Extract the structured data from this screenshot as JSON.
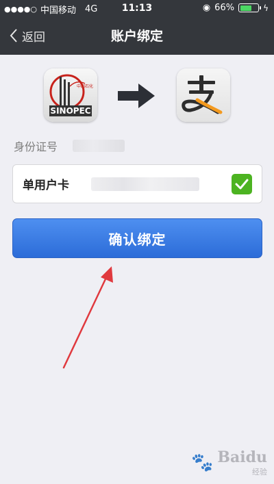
{
  "status_bar": {
    "signal_dots": "●●●●○",
    "carrier": "中国移动",
    "network": "4G",
    "time": "11:13",
    "battery": "66%",
    "battery_level": 0.66
  },
  "nav": {
    "back_label": "返回",
    "title": "账户绑定"
  },
  "logos": {
    "source": "SINOPEC",
    "target": "alipay-logo"
  },
  "form": {
    "id_label": "身份证号",
    "card_label": "单用户卡",
    "checked": true
  },
  "confirm_button": "确认绑定",
  "watermark": {
    "brand": "Baidu",
    "sub": "经验"
  },
  "colors": {
    "header": "#34373c",
    "button": "#3a7ce6",
    "check": "#4cb321",
    "arrow": "#e0393e"
  }
}
